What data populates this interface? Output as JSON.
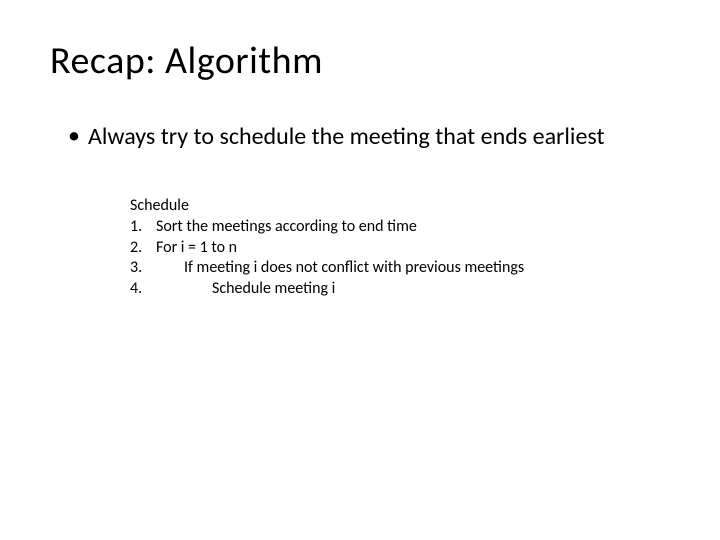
{
  "title": "Recap: Algorithm",
  "bullet": {
    "marker": "•",
    "text": "Always try to schedule the meeting that ends earliest"
  },
  "algorithm": {
    "heading": "Schedule",
    "lines": [
      {
        "num": "1.",
        "text": "Sort the meetings according to end time",
        "indent": 0
      },
      {
        "num": "2.",
        "text": "For i = 1 to n",
        "indent": 0
      },
      {
        "num": "3.",
        "text": "If meeting i does not conflict with previous meetings",
        "indent": 1
      },
      {
        "num": "4.",
        "text": "Schedule meeting i",
        "indent": 2
      }
    ]
  }
}
